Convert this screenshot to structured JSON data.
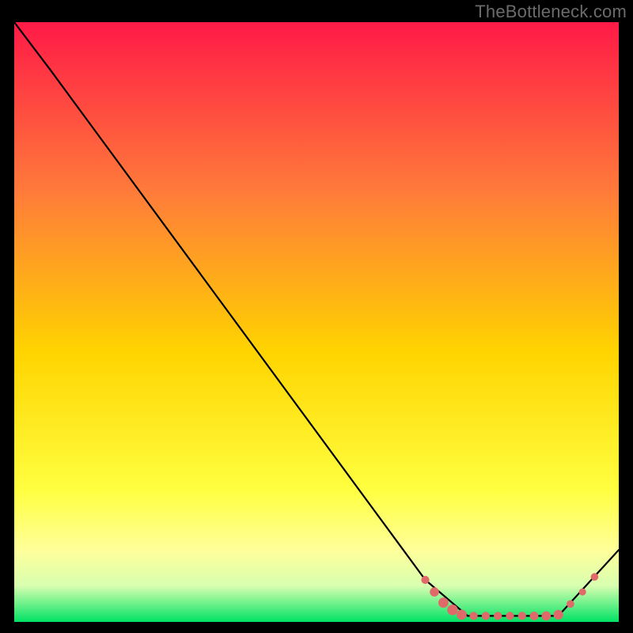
{
  "watermark": "TheBottleneck.com",
  "colors": {
    "bg_black": "#000000",
    "watermark_gray": "#6b6b6b",
    "curve": "#000000",
    "marker_fill": "#e06a6a",
    "marker_dark": "#c75959",
    "gradient_top": "#ff1a47",
    "gradient_mid_top": "#ff7a3a",
    "gradient_mid": "#ffd400",
    "gradient_yellow_pale": "#ffff9a",
    "gradient_green_pale": "#d8ffb0",
    "gradient_green": "#00e264"
  },
  "chart_data": {
    "type": "line",
    "title": "",
    "xlabel": "",
    "ylabel": "",
    "xlim": [
      0,
      100
    ],
    "ylim": [
      0,
      100
    ],
    "series": [
      {
        "name": "curve",
        "x": [
          0,
          6,
          68,
          75,
          90,
          100
        ],
        "y": [
          100,
          92,
          7,
          1,
          1,
          12
        ]
      }
    ],
    "markers": {
      "name": "highlight-band",
      "points": [
        {
          "x": 68,
          "y": 7,
          "r": 3.2
        },
        {
          "x": 69.5,
          "y": 5,
          "r": 3.6
        },
        {
          "x": 71,
          "y": 3.2,
          "r": 4.0
        },
        {
          "x": 72.5,
          "y": 2.0,
          "r": 4.2
        },
        {
          "x": 74,
          "y": 1.2,
          "r": 4.0
        },
        {
          "x": 76,
          "y": 1.0,
          "r": 3.2
        },
        {
          "x": 78,
          "y": 1.0,
          "r": 3.2
        },
        {
          "x": 80,
          "y": 1.0,
          "r": 3.2
        },
        {
          "x": 82,
          "y": 1.0,
          "r": 3.2
        },
        {
          "x": 84,
          "y": 1.0,
          "r": 3.2
        },
        {
          "x": 86,
          "y": 1.0,
          "r": 3.4
        },
        {
          "x": 88,
          "y": 1.0,
          "r": 3.6
        },
        {
          "x": 90,
          "y": 1.2,
          "r": 3.8
        },
        {
          "x": 92,
          "y": 3.0,
          "r": 3.0
        },
        {
          "x": 94,
          "y": 5.0,
          "r": 2.8
        },
        {
          "x": 96,
          "y": 7.5,
          "r": 3.0
        }
      ]
    }
  }
}
